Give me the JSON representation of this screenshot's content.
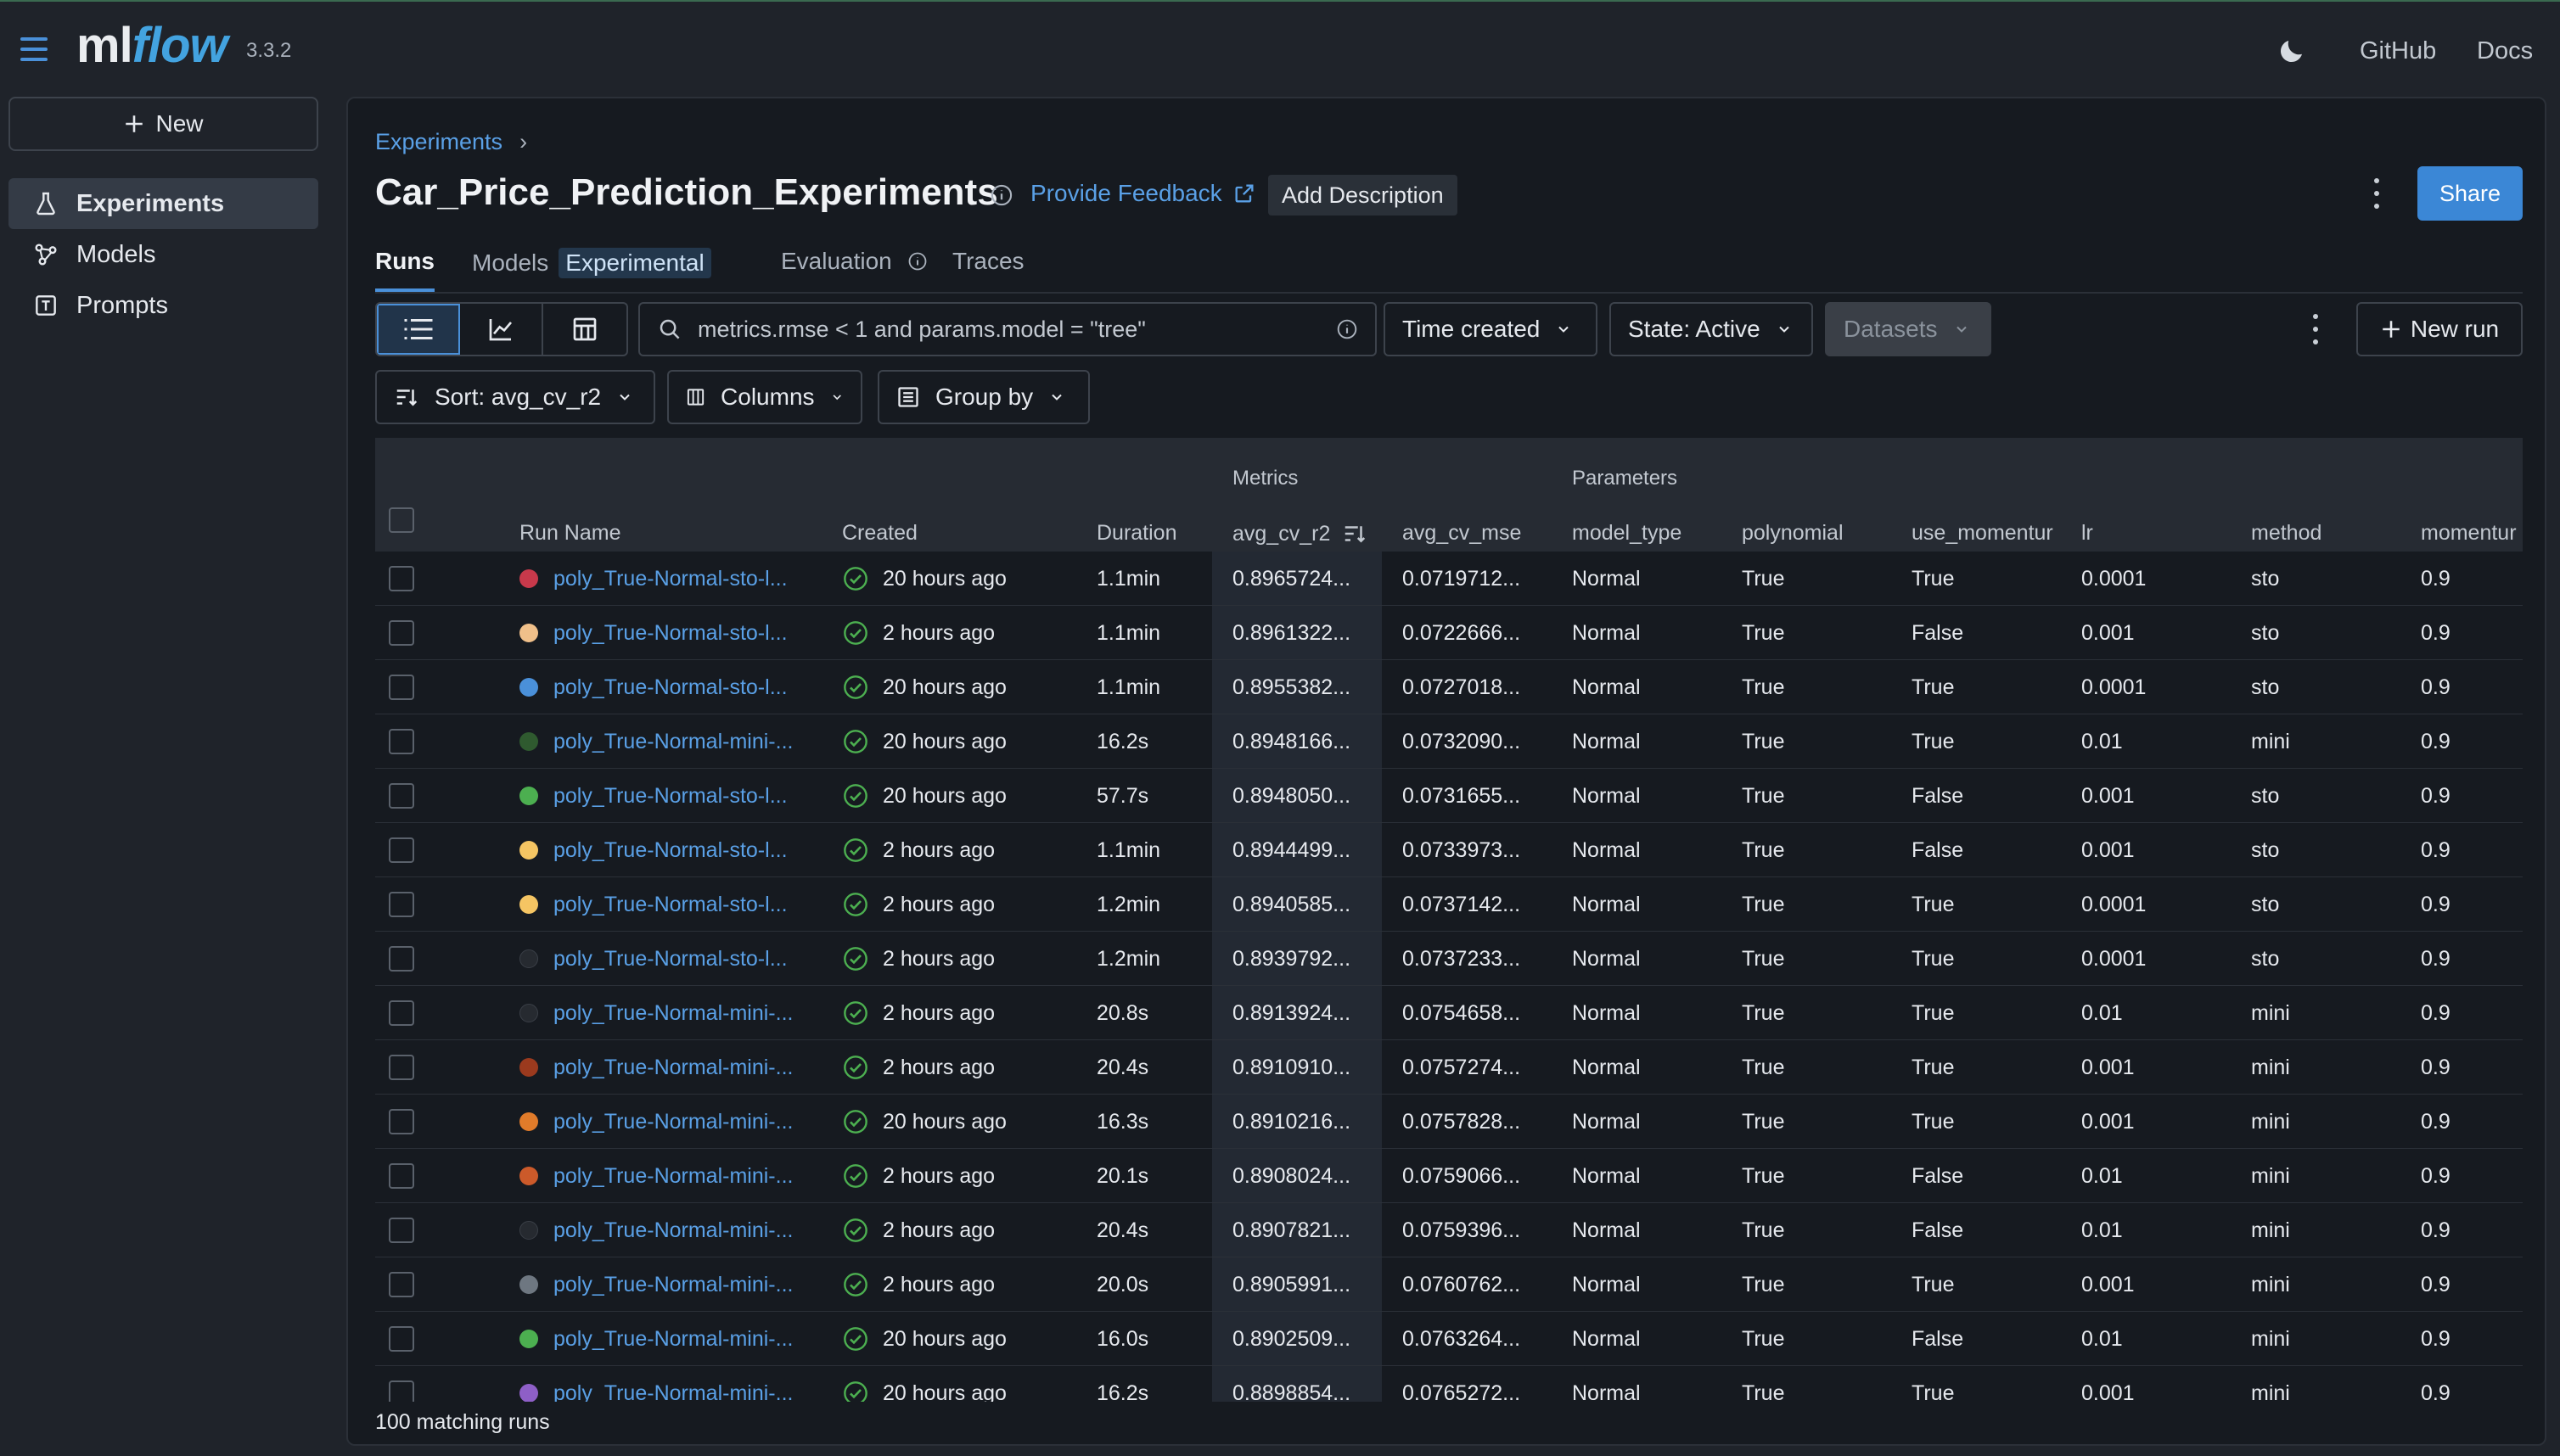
{
  "app": {
    "logo_ml": "ml",
    "logo_flow": "flow",
    "version": "3.3.2"
  },
  "topnav": {
    "github": "GitHub",
    "docs": "Docs"
  },
  "sidebar": {
    "new_label": "New",
    "items": [
      {
        "label": "Experiments",
        "icon": "beaker-icon",
        "active": true
      },
      {
        "label": "Models",
        "icon": "models-icon",
        "active": false
      },
      {
        "label": "Prompts",
        "icon": "prompts-icon",
        "active": false
      }
    ]
  },
  "header": {
    "breadcrumb": "Experiments",
    "title": "Car_Price_Prediction_Experiments",
    "feedback": "Provide Feedback",
    "add_description": "Add Description",
    "share": "Share"
  },
  "tabs": {
    "runs": "Runs",
    "models": "Models",
    "models_badge": "Experimental",
    "evaluation": "Evaluation",
    "traces": "Traces"
  },
  "toolbar": {
    "search_placeholder": "metrics.rmse < 1 and params.model = \"tree\"",
    "time_created": "Time created",
    "state": "State: Active",
    "datasets": "Datasets",
    "new_run": "New run",
    "sort": "Sort: avg_cv_r2",
    "columns": "Columns",
    "group_by": "Group by"
  },
  "table": {
    "groups": {
      "metrics": "Metrics",
      "parameters": "Parameters"
    },
    "headers": {
      "run_name": "Run Name",
      "created": "Created",
      "duration": "Duration",
      "avg_cv_r2": "avg_cv_r2",
      "avg_cv_mse": "avg_cv_mse",
      "model_type": "model_type",
      "polynomial": "polynomial",
      "use_momentum": "use_momentur",
      "lr": "lr",
      "method": "method",
      "momentum": "momentur"
    },
    "rows": [
      {
        "color": "#c8394b",
        "name": "poly_True-Normal-sto-l...",
        "created": "20 hours ago",
        "duration": "1.1min",
        "r2": "0.8965724...",
        "mse": "0.0719712...",
        "model_type": "Normal",
        "polynomial": "True",
        "use_momentum": "True",
        "lr": "0.0001",
        "method": "sto",
        "momentum": "0.9"
      },
      {
        "color": "#f0c08a",
        "name": "poly_True-Normal-sto-l...",
        "created": "2 hours ago",
        "duration": "1.1min",
        "r2": "0.8961322...",
        "mse": "0.0722666...",
        "model_type": "Normal",
        "polynomial": "True",
        "use_momentum": "False",
        "lr": "0.001",
        "method": "sto",
        "momentum": "0.9"
      },
      {
        "color": "#4a90d9",
        "name": "poly_True-Normal-sto-l...",
        "created": "20 hours ago",
        "duration": "1.1min",
        "r2": "0.8955382...",
        "mse": "0.0727018...",
        "model_type": "Normal",
        "polynomial": "True",
        "use_momentum": "True",
        "lr": "0.0001",
        "method": "sto",
        "momentum": "0.9"
      },
      {
        "color": "#2f5a2f",
        "name": "poly_True-Normal-mini-...",
        "created": "20 hours ago",
        "duration": "16.2s",
        "r2": "0.8948166...",
        "mse": "0.0732090...",
        "model_type": "Normal",
        "polynomial": "True",
        "use_momentum": "True",
        "lr": "0.01",
        "method": "mini",
        "momentum": "0.9"
      },
      {
        "color": "#4caf50",
        "name": "poly_True-Normal-sto-l...",
        "created": "20 hours ago",
        "duration": "57.7s",
        "r2": "0.8948050...",
        "mse": "0.0731655...",
        "model_type": "Normal",
        "polynomial": "True",
        "use_momentum": "False",
        "lr": "0.001",
        "method": "sto",
        "momentum": "0.9"
      },
      {
        "color": "#f5c563",
        "name": "poly_True-Normal-sto-l...",
        "created": "2 hours ago",
        "duration": "1.1min",
        "r2": "0.8944499...",
        "mse": "0.0733973...",
        "model_type": "Normal",
        "polynomial": "True",
        "use_momentum": "False",
        "lr": "0.001",
        "method": "sto",
        "momentum": "0.9"
      },
      {
        "color": "#f5c563",
        "name": "poly_True-Normal-sto-l...",
        "created": "2 hours ago",
        "duration": "1.2min",
        "r2": "0.8940585...",
        "mse": "0.0737142...",
        "model_type": "Normal",
        "polynomial": "True",
        "use_momentum": "True",
        "lr": "0.0001",
        "method": "sto",
        "momentum": "0.9"
      },
      {
        "color": "#262a30",
        "name": "poly_True-Normal-sto-l...",
        "created": "2 hours ago",
        "duration": "1.2min",
        "r2": "0.8939792...",
        "mse": "0.0737233...",
        "model_type": "Normal",
        "polynomial": "True",
        "use_momentum": "True",
        "lr": "0.0001",
        "method": "sto",
        "momentum": "0.9"
      },
      {
        "color": "#262a30",
        "name": "poly_True-Normal-mini-...",
        "created": "2 hours ago",
        "duration": "20.8s",
        "r2": "0.8913924...",
        "mse": "0.0754658...",
        "model_type": "Normal",
        "polynomial": "True",
        "use_momentum": "True",
        "lr": "0.01",
        "method": "mini",
        "momentum": "0.9"
      },
      {
        "color": "#9b3a1e",
        "name": "poly_True-Normal-mini-...",
        "created": "2 hours ago",
        "duration": "20.4s",
        "r2": "0.8910910...",
        "mse": "0.0757274...",
        "model_type": "Normal",
        "polynomial": "True",
        "use_momentum": "True",
        "lr": "0.001",
        "method": "mini",
        "momentum": "0.9"
      },
      {
        "color": "#e07b2a",
        "name": "poly_True-Normal-mini-...",
        "created": "20 hours ago",
        "duration": "16.3s",
        "r2": "0.8910216...",
        "mse": "0.0757828...",
        "model_type": "Normal",
        "polynomial": "True",
        "use_momentum": "True",
        "lr": "0.001",
        "method": "mini",
        "momentum": "0.9"
      },
      {
        "color": "#cc5a2a",
        "name": "poly_True-Normal-mini-...",
        "created": "2 hours ago",
        "duration": "20.1s",
        "r2": "0.8908024...",
        "mse": "0.0759066...",
        "model_type": "Normal",
        "polynomial": "True",
        "use_momentum": "False",
        "lr": "0.01",
        "method": "mini",
        "momentum": "0.9"
      },
      {
        "color": "#262a30",
        "name": "poly_True-Normal-mini-...",
        "created": "2 hours ago",
        "duration": "20.4s",
        "r2": "0.8907821...",
        "mse": "0.0759396...",
        "model_type": "Normal",
        "polynomial": "True",
        "use_momentum": "False",
        "lr": "0.01",
        "method": "mini",
        "momentum": "0.9"
      },
      {
        "color": "#6e7781",
        "name": "poly_True-Normal-mini-...",
        "created": "2 hours ago",
        "duration": "20.0s",
        "r2": "0.8905991...",
        "mse": "0.0760762...",
        "model_type": "Normal",
        "polynomial": "True",
        "use_momentum": "True",
        "lr": "0.001",
        "method": "mini",
        "momentum": "0.9"
      },
      {
        "color": "#4caf50",
        "name": "poly_True-Normal-mini-...",
        "created": "20 hours ago",
        "duration": "16.0s",
        "r2": "0.8902509...",
        "mse": "0.0763264...",
        "model_type": "Normal",
        "polynomial": "True",
        "use_momentum": "False",
        "lr": "0.01",
        "method": "mini",
        "momentum": "0.9"
      },
      {
        "color": "#8e5fc7",
        "name": "poly_True-Normal-mini-...",
        "created": "20 hours ago",
        "duration": "16.2s",
        "r2": "0.8898854...",
        "mse": "0.0765272...",
        "model_type": "Normal",
        "polynomial": "True",
        "use_momentum": "True",
        "lr": "0.001",
        "method": "mini",
        "momentum": "0.9"
      }
    ]
  },
  "footer": {
    "matching_runs": "100 matching runs"
  }
}
